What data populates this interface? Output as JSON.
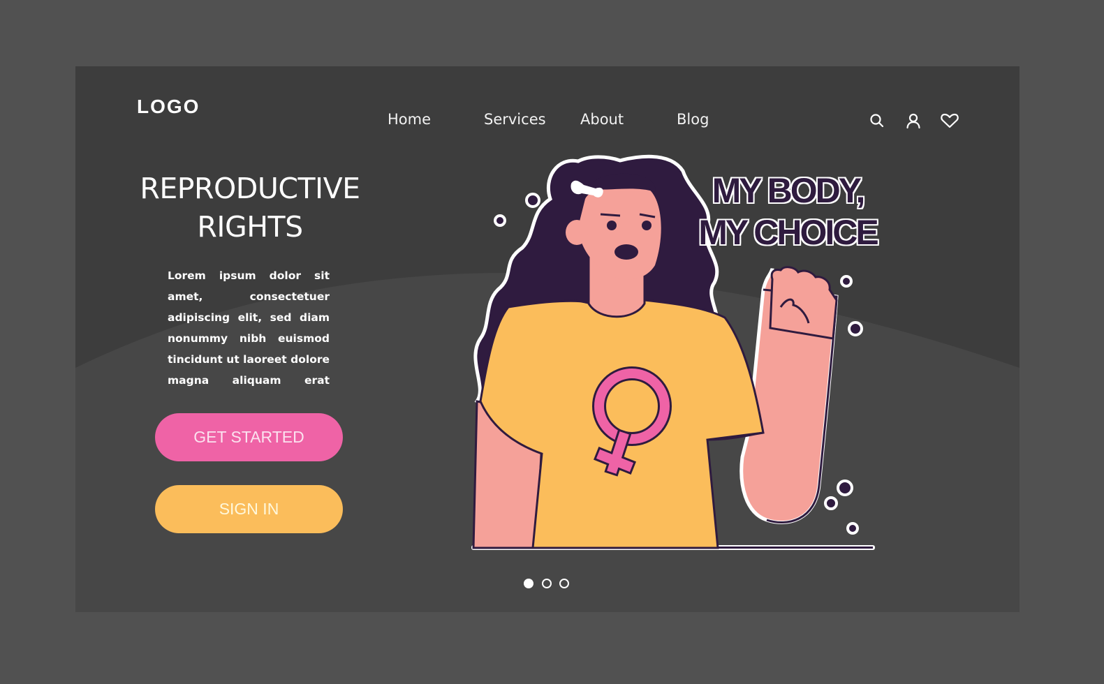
{
  "header": {
    "logo": "LOGO",
    "nav": [
      {
        "label": "Home"
      },
      {
        "label": "Services"
      },
      {
        "label": "About"
      },
      {
        "label": "Blog"
      }
    ],
    "icons": [
      "search-icon",
      "user-icon",
      "heart-icon"
    ]
  },
  "hero": {
    "title_line1": "REPRODUCTIVE",
    "title_line2": "RIGHTS",
    "body": "Lorem ipsum dolor sit amet, consectetuer adipiscing elit, sed diam nonummy nibh eu­ismod tincidunt ut laoreet dolore magna aliquam erat volutpat. Ut wisi enim ad",
    "primary_button": "GET STARTED",
    "secondary_button": "SIGN IN"
  },
  "illustration": {
    "slogan_line1": "MY BODY,",
    "slogan_line2": "MY CHOICE",
    "symbol": "female-symbol"
  },
  "carousel": {
    "total": 3,
    "active": 1
  },
  "colors": {
    "outer_bg": "#515151",
    "frame_bg": "#3d3d3d",
    "pink": "#ef63a6",
    "yellow": "#fbbd5b",
    "skin": "#f5a199",
    "hair": "#2f1b3f"
  }
}
